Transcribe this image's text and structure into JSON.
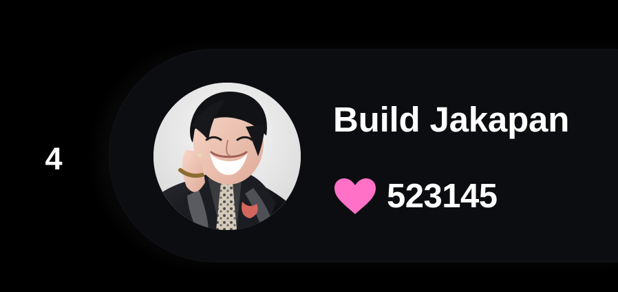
{
  "leaderboard": {
    "rank": "4",
    "user": {
      "name": "Build Jakapan",
      "likes": "523145",
      "avatar_icon": "user-avatar-photo"
    }
  },
  "icons": {
    "likes_icon": "heart-icon"
  },
  "colors": {
    "background": "#000000",
    "card": "#0c0d10",
    "text": "#ffffff",
    "heart": "#ff71c7"
  }
}
